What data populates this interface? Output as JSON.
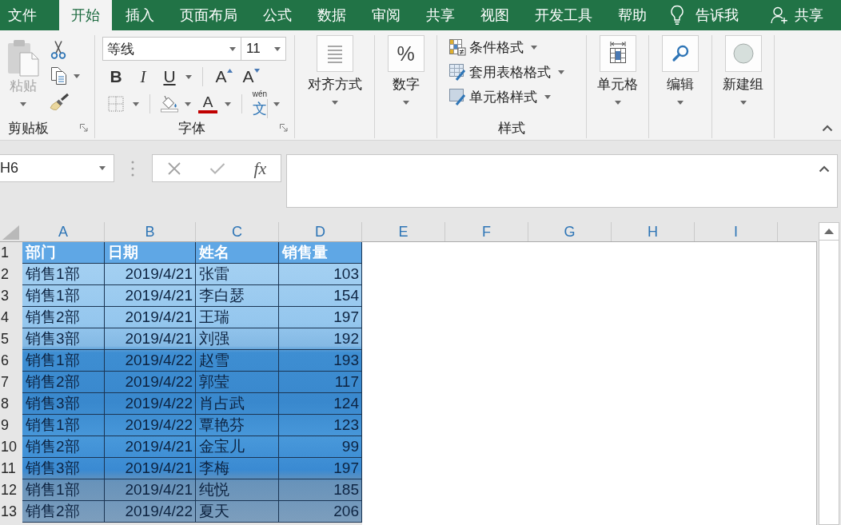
{
  "tabs": [
    {
      "label": "文件",
      "selected": false
    },
    {
      "label": "开始",
      "selected": true
    },
    {
      "label": "插入",
      "selected": false
    },
    {
      "label": "页面布局",
      "selected": false
    },
    {
      "label": "公式",
      "selected": false
    },
    {
      "label": "数据",
      "selected": false
    },
    {
      "label": "审阅",
      "selected": false
    },
    {
      "label": "共享",
      "selected": false
    },
    {
      "label": "视图",
      "selected": false
    },
    {
      "label": "开发工具",
      "selected": false
    },
    {
      "label": "帮助",
      "selected": false
    }
  ],
  "tell_me": {
    "label": "告诉我"
  },
  "share": {
    "label": "共享"
  },
  "ribbon_groups": [
    {
      "kind": "clipboard",
      "label": "剪贴板",
      "paste": {
        "label": "粘贴",
        "disabled": true
      }
    },
    {
      "kind": "font",
      "label": "字体",
      "font_name": "等线",
      "font_size": "11",
      "style_buttons": [
        {
          "kind": "bold",
          "label": "B"
        },
        {
          "kind": "italic",
          "label": "I"
        },
        {
          "kind": "underline",
          "label": "U"
        }
      ],
      "size_buttons": [
        {
          "kind": "grow",
          "label": "A"
        },
        {
          "kind": "shrink",
          "label": "A"
        }
      ],
      "font_color": {
        "label": "A"
      },
      "phonetic": {
        "pinyin": "wén",
        "character": "文"
      }
    },
    {
      "kind": "alignment",
      "label": "对齐方式"
    },
    {
      "kind": "number",
      "label": "数字",
      "symbol": "%"
    },
    {
      "kind": "styles",
      "label": "样式",
      "items": [
        {
          "kind": "conditional",
          "label": "条件格式"
        },
        {
          "kind": "table",
          "label": "套用表格格式"
        },
        {
          "kind": "cell",
          "label": "单元格样式"
        }
      ]
    },
    {
      "kind": "cells",
      "label": "单元格"
    },
    {
      "kind": "editing",
      "label": "编辑"
    },
    {
      "kind": "new_group",
      "label": "新建组"
    }
  ],
  "formula_bar": {
    "name_box": "H6",
    "function_label": "fx"
  },
  "sheet": {
    "columns": [
      "A",
      "B",
      "C",
      "D",
      "E",
      "F",
      "G",
      "H",
      "I"
    ],
    "rows": [
      {
        "number": "1",
        "kind": "header",
        "cells": [
          "部门",
          "日期",
          "姓名",
          "销售量"
        ]
      },
      {
        "number": "2",
        "kind": "data",
        "cells": [
          "销售1部",
          "2019/4/21",
          "张雷",
          "103"
        ]
      },
      {
        "number": "3",
        "kind": "data",
        "cells": [
          "销售1部",
          "2019/4/21",
          "李白瑟",
          "154"
        ]
      },
      {
        "number": "4",
        "kind": "data",
        "cells": [
          "销售2部",
          "2019/4/21",
          "王瑞",
          "197"
        ]
      },
      {
        "number": "5",
        "kind": "data",
        "cells": [
          "销售3部",
          "2019/4/21",
          "刘强",
          "192"
        ]
      },
      {
        "number": "6",
        "kind": "data",
        "cells": [
          "销售1部",
          "2019/4/22",
          "赵雪",
          "193"
        ]
      },
      {
        "number": "7",
        "kind": "data",
        "cells": [
          "销售2部",
          "2019/4/22",
          "郭莹",
          "117"
        ]
      },
      {
        "number": "8",
        "kind": "data",
        "cells": [
          "销售3部",
          "2019/4/22",
          "肖占武",
          "124"
        ]
      },
      {
        "number": "9",
        "kind": "data",
        "cells": [
          "销售1部",
          "2019/4/22",
          "覃艳芬",
          "123"
        ]
      },
      {
        "number": "10",
        "kind": "data",
        "cells": [
          "销售2部",
          "2019/4/21",
          "金宝儿",
          "99"
        ]
      },
      {
        "number": "11",
        "kind": "data",
        "cells": [
          "销售3部",
          "2019/4/21",
          "李梅",
          "197"
        ]
      },
      {
        "number": "12",
        "kind": "data",
        "cells": [
          "销售1部",
          "2019/4/21",
          "纯悦",
          "185"
        ]
      },
      {
        "number": "13",
        "kind": "data",
        "cells": [
          "销售2部",
          "2019/4/22",
          "夏天",
          "206"
        ]
      }
    ]
  }
}
